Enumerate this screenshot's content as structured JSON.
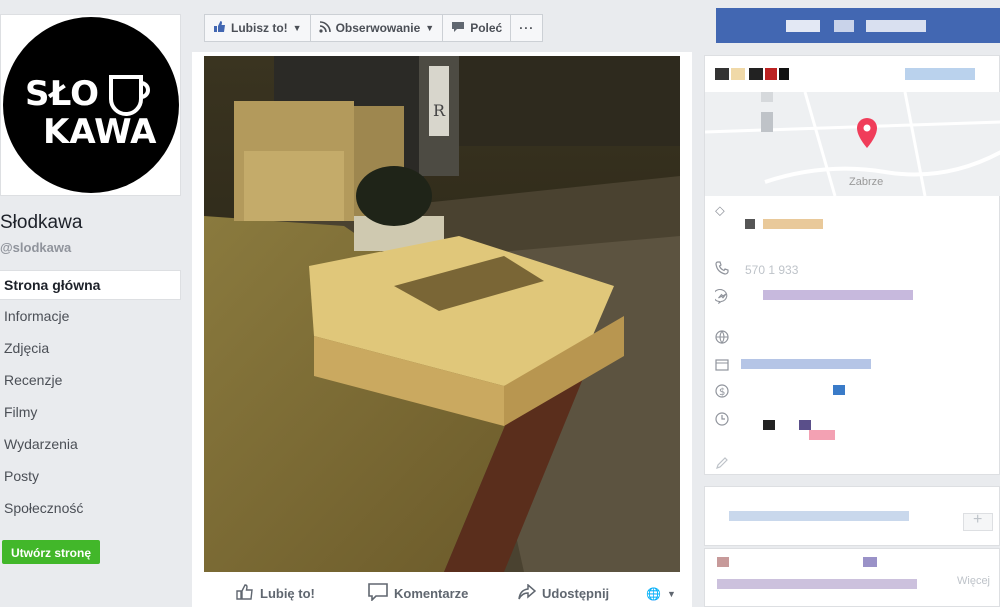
{
  "page": {
    "logo_text": "SŁODKAWA",
    "name": "Słodkawa",
    "handle": "@slodkawa"
  },
  "nav": {
    "items": [
      {
        "label": "Strona główna"
      },
      {
        "label": "Informacje"
      },
      {
        "label": "Zdjęcia"
      },
      {
        "label": "Recenzje"
      },
      {
        "label": "Filmy"
      },
      {
        "label": "Wydarzenia"
      },
      {
        "label": "Posty"
      },
      {
        "label": "Społeczność"
      }
    ],
    "create_page_label": "Utwórz stronę"
  },
  "actionbar": {
    "like_label": "Lubisz to!",
    "follow_label": "Obserwowanie",
    "recommend_label": "Poleć",
    "more_label": "···"
  },
  "photo": {
    "like_label": "Lubię to!",
    "comment_label": "Komentarze",
    "share_label": "Udostępnij"
  },
  "info": {
    "map_label": "Zabrze",
    "phone_partial": "570 1  933",
    "more_label": "Więcej"
  },
  "icons": {
    "like": "thumbs-up-icon",
    "follow": "rss-icon",
    "recommend": "speech-bubble-icon",
    "phone": "phone-icon",
    "messenger": "messenger-icon",
    "globe": "globe-icon",
    "calendar": "calendar-icon",
    "price": "dollar-icon",
    "clock": "clock-icon",
    "edit": "pencil-icon"
  },
  "colors": {
    "brand_blue": "#4267b2",
    "create_green": "#42b72a",
    "map_pin": "#f03d5a"
  }
}
